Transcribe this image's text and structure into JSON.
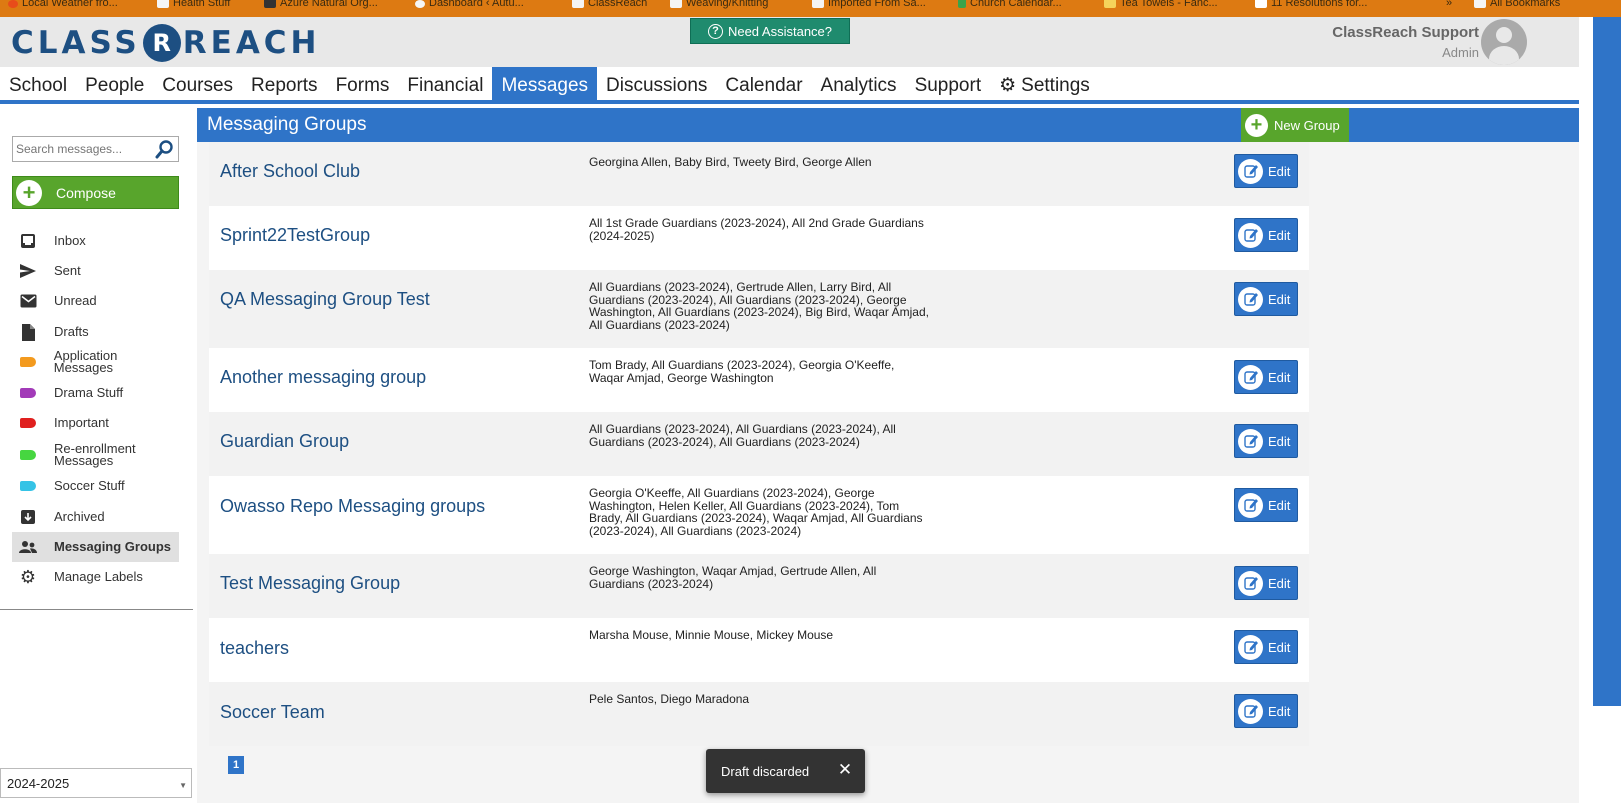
{
  "bookmarks": [
    {
      "label": "Local Weather fro..."
    },
    {
      "label": "Health Stuff"
    },
    {
      "label": "Azure Natural Org..."
    },
    {
      "label": "Dashboard ‹ Autu..."
    },
    {
      "label": "ClassReach"
    },
    {
      "label": "Weaving/Knitting"
    },
    {
      "label": "Imported From Sa..."
    },
    {
      "label": "Church Calendar..."
    },
    {
      "label": "Tea Towels - Fanc..."
    },
    {
      "label": "11 Resolutions for..."
    },
    {
      "label": "»"
    },
    {
      "label": "All Bookmarks"
    }
  ],
  "header": {
    "logo_left": "CLASS",
    "logo_mark": "R",
    "logo_right": "REACH",
    "assist_label": "Need Assistance?",
    "user_name": "ClassReach Support",
    "user_role": "Admin"
  },
  "nav": [
    {
      "label": "School"
    },
    {
      "label": "People"
    },
    {
      "label": "Courses"
    },
    {
      "label": "Reports"
    },
    {
      "label": "Forms"
    },
    {
      "label": "Financial"
    },
    {
      "label": "Messages",
      "active": true
    },
    {
      "label": "Discussions"
    },
    {
      "label": "Calendar"
    },
    {
      "label": "Analytics"
    },
    {
      "label": "Support"
    },
    {
      "label": "Settings"
    }
  ],
  "sidebar": {
    "search_placeholder": "Search messages...",
    "compose_label": "Compose",
    "items": [
      {
        "label": "Inbox",
        "icon": "inbox-icon"
      },
      {
        "label": "Sent",
        "icon": "send-icon"
      },
      {
        "label": "Unread",
        "icon": "envelope-icon"
      },
      {
        "label": "Drafts",
        "icon": "draft-document-icon"
      },
      {
        "label": "Application Messages",
        "icon": "label-tag-icon",
        "color": "#f39a1e"
      },
      {
        "label": "Drama Stuff",
        "icon": "label-tag-icon",
        "color": "#a23ab8"
      },
      {
        "label": "Important",
        "icon": "label-tag-icon",
        "color": "#e0201f"
      },
      {
        "label": "Re-enrollment Messages",
        "icon": "label-tag-icon",
        "color": "#46d640"
      },
      {
        "label": "Soccer Stuff",
        "icon": "label-tag-icon",
        "color": "#35c3e6"
      },
      {
        "label": "Archived",
        "icon": "archive-icon"
      },
      {
        "label": "Messaging Groups",
        "icon": "people-icon",
        "active": true
      },
      {
        "label": "Manage Labels",
        "icon": "gear-icon"
      }
    ],
    "school_year": "2024-2025"
  },
  "content": {
    "title": "Messaging Groups",
    "new_group_label": "New Group",
    "edit_label": "Edit",
    "groups": [
      {
        "name": "After School Club",
        "members": "Georgina Allen, Baby Bird, Tweety Bird, George Allen"
      },
      {
        "name": "Sprint22TestGroup",
        "members": "All 1st Grade Guardians (2023-2024), All 2nd Grade Guardians (2024-2025)"
      },
      {
        "name": "QA Messaging Group Test",
        "members": "All Guardians (2023-2024), Gertrude Allen, Larry Bird, All Guardians (2023-2024), All Guardians (2023-2024), George Washington, All Guardians (2023-2024), Big Bird, Waqar Amjad, All Guardians (2023-2024)"
      },
      {
        "name": "Another messaging group",
        "members": "Tom Brady, All Guardians (2023-2024), Georgia O'Keeffe, Waqar Amjad, George Washington"
      },
      {
        "name": "Guardian Group",
        "members": "All Guardians (2023-2024), All Guardians (2023-2024), All Guardians (2023-2024), All Guardians (2023-2024)"
      },
      {
        "name": "Owasso Repo Messaging groups",
        "members": "Georgia O'Keeffe, All Guardians (2023-2024), George Washington, Helen Keller, All Guardians (2023-2024), Tom Brady, All Guardians (2023-2024), Waqar Amjad, All Guardians (2023-2024), All Guardians (2023-2024)"
      },
      {
        "name": "Test Messaging Group",
        "members": "George Washington, Waqar Amjad, Gertrude Allen, All Guardians (2023-2024)"
      },
      {
        "name": "teachers",
        "members": "Marsha Mouse, Minnie Mouse, Mickey Mouse"
      },
      {
        "name": "Soccer Team",
        "members": "Pele Santos, Diego Maradona"
      }
    ],
    "page": "1"
  },
  "toast": {
    "message": "Draft discarded",
    "close": "✕"
  },
  "colors": {
    "bookmarks_bar": "#dd7a12",
    "brand_blue": "#2f74c8",
    "logo_navy": "#1d4f82",
    "green": "#58a52c",
    "assist_green": "#1f8b6e"
  }
}
